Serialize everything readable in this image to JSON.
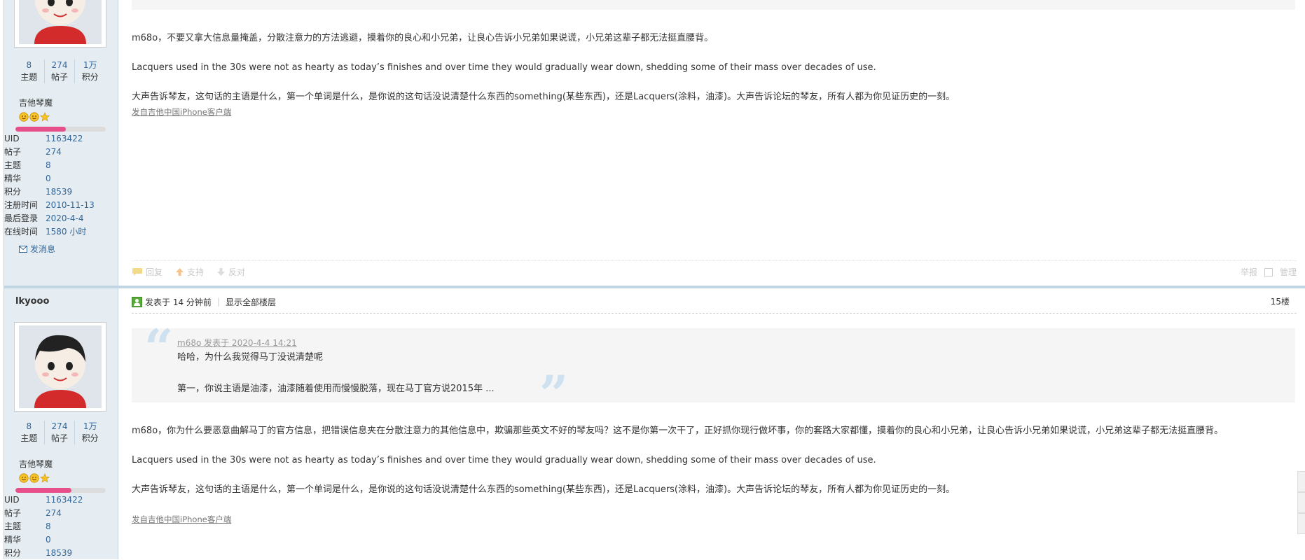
{
  "post1": {
    "user": {
      "stats": [
        {
          "num": "8",
          "label": "主题"
        },
        {
          "num": "274",
          "label": "帖子"
        },
        {
          "num": "1万",
          "label": "积分"
        }
      ],
      "group": "吉他琴魔",
      "level_fill": 0.56,
      "info": [
        {
          "k": "UID",
          "v": "1163422"
        },
        {
          "k": "帖子",
          "v": "274"
        },
        {
          "k": "主题",
          "v": "8"
        },
        {
          "k": "精华",
          "v": "0"
        },
        {
          "k": "积分",
          "v": "18539"
        },
        {
          "k": "注册时间",
          "v": "2010-11-13"
        },
        {
          "k": "最后登录",
          "v": "2020-4-4"
        },
        {
          "k": "在线时间",
          "v": "1580 小时"
        }
      ],
      "send_message": "发消息"
    },
    "body": [
      "m68o，不要又拿大信息量掩盖，分散注意力的方法逃避，摸着你的良心和小兄弟，让良心告诉小兄弟如果说谎，小兄弟这辈子都无法挺直腰背。",
      "Lacquers used in the 30s were not as hearty as today’s finishes and over time they would gradually wear down, shedding some of their mass over decades of use.",
      "大声告诉琴友，这句话的主语是什么，第一个单词是什么，是你说的这句话没说清楚什么东西的something(某些东西)，还是Lacquers(涂料，油漆)。大声告诉论坛的琴友，所有人都为你见证历史的一刻。"
    ],
    "source": "发自吉他中国iPhone客户端",
    "actions": {
      "reply": "回复",
      "support": "支持",
      "oppose": "反对",
      "report": "举报",
      "manage": "管理"
    }
  },
  "post2": {
    "username": "lkyooo",
    "time": "发表于 14 分钟前",
    "show_all": "显示全部楼层",
    "floor": "15楼",
    "quote": {
      "author": "m68o 发表于 2020-4-4 14:21",
      "line1": "哈哈，为什么我觉得马丁没说清楚呢",
      "line2": "第一，你说主语是油漆，油漆随着使用而慢慢脱落，现在马丁官方说2015年 ..."
    },
    "user": {
      "stats": [
        {
          "num": "8",
          "label": "主题"
        },
        {
          "num": "274",
          "label": "帖子"
        },
        {
          "num": "1万",
          "label": "积分"
        }
      ],
      "group": "吉他琴魔",
      "level_fill": 0.62,
      "info": [
        {
          "k": "UID",
          "v": "1163422"
        },
        {
          "k": "帖子",
          "v": "274"
        },
        {
          "k": "主题",
          "v": "8"
        },
        {
          "k": "精华",
          "v": "0"
        },
        {
          "k": "积分",
          "v": "18539"
        }
      ]
    },
    "body": [
      "m68o，你为什么要恶意曲解马丁的官方信息，把错误信息夹在分散注意力的其他信息中，欺骗那些英文不好的琴友吗？这不是你第一次干了，正好抓你现行做坏事，你的套路大家都懂，摸着你的良心和小兄弟，让良心告诉小兄弟如果说谎，小兄弟这辈子都无法挺直腰背。",
      "Lacquers used in the 30s were not as hearty as today’s finishes and over time they would gradually wear down, shedding some of their mass over decades of use.",
      "大声告诉琴友，这句话的主语是什么，第一个单词是什么，是你说的这句话没说清楚什么东西的something(某些东西)，还是Lacquers(涂料，油漆)。大声告诉论坛的琴友，所有人都为你见证历史的一刻。"
    ],
    "source": "发自吉他中国iPhone客户端"
  },
  "colors": {
    "sidebar_bg": "#e5edf2",
    "border": "#c2d5e3",
    "link": "#336699",
    "level_bar": "#e64f8a",
    "quote_bg": "#f5f5f5"
  }
}
